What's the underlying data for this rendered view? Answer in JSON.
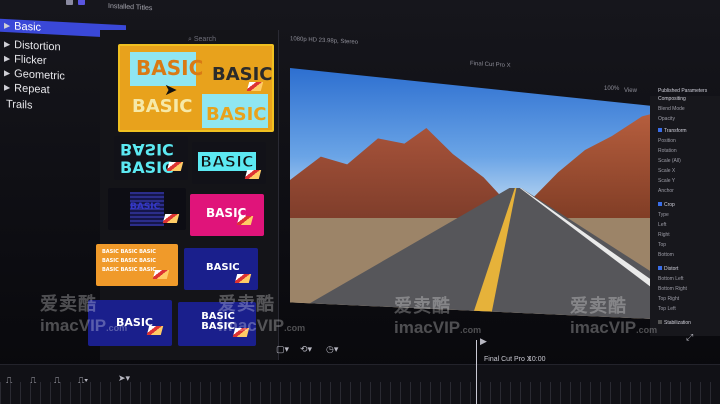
{
  "app": {
    "topbar_title": "Installed Titles",
    "viewer_format": "1080p HD 23.98p, Stereo",
    "viewer_clip_name": "Final Cut Pro X",
    "zoom": "100%",
    "view_label": "View"
  },
  "categories": [
    {
      "label": "Basic",
      "selected": true
    },
    {
      "label": "Distortion",
      "selected": false
    },
    {
      "label": "Flicker",
      "selected": false
    },
    {
      "label": "Geometric",
      "selected": false
    },
    {
      "label": "Repeat",
      "selected": false
    },
    {
      "label": "Trails",
      "selected": false
    }
  ],
  "search": {
    "placeholder": "Search"
  },
  "thumbnails": [
    {
      "text": "BASIC",
      "style": "yellow-cyan",
      "selected": true
    },
    {
      "text": "BASIC",
      "style": "cyan-mirror"
    },
    {
      "text": "BASIC",
      "style": "cyan-outline"
    },
    {
      "text": "BASIC",
      "style": "dark-blue"
    },
    {
      "text": "BASIC",
      "style": "magenta"
    },
    {
      "text": "BASIC",
      "style": "orange-grid"
    },
    {
      "text": "BASIC",
      "style": "navy"
    },
    {
      "text": "BASIC",
      "style": "navy"
    },
    {
      "text": "BASIC BASIC",
      "style": "navy"
    }
  ],
  "inspector": {
    "title": "Published Parameters",
    "rows": [
      "Compositing",
      "Blend Mode",
      "Opacity",
      "Transform",
      "Position",
      "Rotation",
      "Scale (All)",
      "Scale X",
      "Scale Y",
      "Anchor",
      "Crop",
      "Type",
      "Left",
      "Right",
      "Top",
      "Bottom",
      "Distort",
      "Bottom Left",
      "Bottom Right",
      "Top Right",
      "Top Left",
      "Stabilization"
    ]
  },
  "timeline": {
    "clip_name": "Final Cut Pro X",
    "timecode": "10:00"
  },
  "watermark": {
    "cn": "爱卖酷",
    "en": "imacVIP",
    "suffix": ".com"
  },
  "colors": {
    "accent": "#3a48d8",
    "selection": "#f0c020"
  }
}
